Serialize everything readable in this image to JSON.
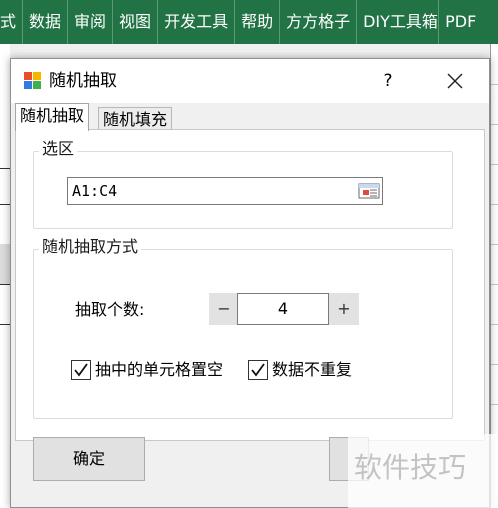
{
  "ribbon": {
    "tabs": [
      "式",
      "数据",
      "审阅",
      "视图",
      "开发工具",
      "帮助",
      "方方格子",
      "DIY工具箱",
      "PDF"
    ]
  },
  "dialog": {
    "title": "随机抽取",
    "help": "?",
    "tabs": [
      {
        "label": "随机抽取",
        "active": true
      },
      {
        "label": "随机填充",
        "active": false
      }
    ],
    "selection_group": {
      "label": "选区",
      "range_value": "A1:C4"
    },
    "method_group": {
      "label": "随机抽取方式",
      "count_label": "抽取个数:",
      "decrement": "−",
      "count_value": "4",
      "increment": "+",
      "options": [
        {
          "label": "抽中的单元格置空",
          "checked": true
        },
        {
          "label": "数据不重复",
          "checked": true
        }
      ]
    },
    "ok_button": "确定"
  },
  "watermark": "软件技巧",
  "colors": {
    "ribbon_green": "#217346",
    "dialog_bg": "#f0f0f0",
    "button_bg": "#e1e1e1"
  }
}
